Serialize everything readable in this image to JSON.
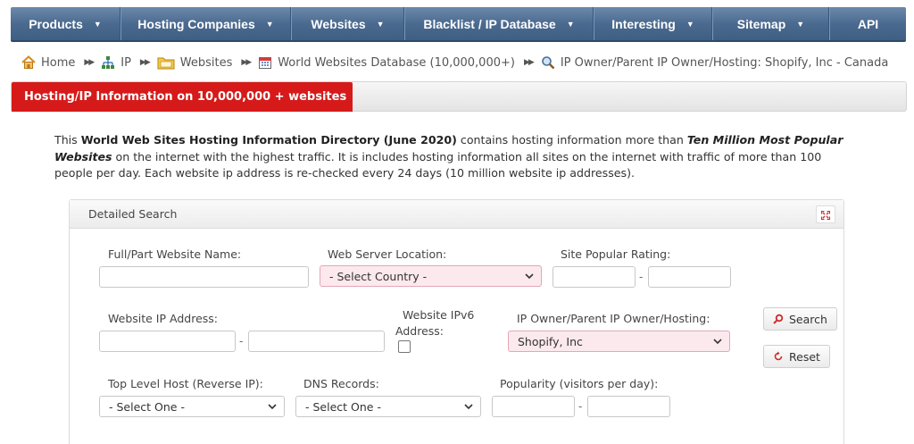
{
  "nav": {
    "items": [
      {
        "label": "Products",
        "has_caret": true,
        "width": 123
      },
      {
        "label": "Hosting Companies",
        "has_caret": true,
        "width": 191
      },
      {
        "label": "Websites",
        "has_caret": true,
        "width": 127
      },
      {
        "label": "Blacklist / IP Database",
        "has_caret": true,
        "width": 212
      },
      {
        "label": "Interesting",
        "has_caret": true,
        "width": 133
      },
      {
        "label": "Sitemap",
        "has_caret": true,
        "width": 131
      },
      {
        "label": "API",
        "has_caret": false,
        "width": 86
      }
    ],
    "caret": "▼"
  },
  "breadcrumb": {
    "home": "Home",
    "ip": "IP",
    "websites": "Websites",
    "database": "World Websites Database (10,000,000+)",
    "current": "IP Owner/Parent IP Owner/Hosting: Shopify, Inc - Canada",
    "separator": "▶▶"
  },
  "tab": {
    "label": "Hosting/IP Information on 10,000,000 + websites"
  },
  "intro": {
    "p1": "This ",
    "bold1": "World Web Sites Hosting Information Directory (June 2020)",
    "p2": " contains hosting information more than ",
    "bold2": "Ten Million Most Popular Websites",
    "p3": " on the internet with the highest traffic. It is includes hosting information all sites on the internet with traffic of more than 100 people per day. Each website ip address is re-checked every 24 days (10 million website ip addresses)."
  },
  "search": {
    "title": "Detailed Search",
    "website_name_label": "Full/Part Website Name:",
    "website_name_value": "",
    "server_location_label": "Web Server Location:",
    "server_location_value": "- Select Country -",
    "popular_rating_label": "Site Popular Rating:",
    "popular_from": "",
    "popular_to": "",
    "ip_label": "Website IP Address:",
    "ip_from": "",
    "ip_to": "",
    "ipv6_label_1": "Website IPv6",
    "ipv6_label_2": "Address:",
    "owner_label": "IP Owner/Parent IP Owner/Hosting:",
    "owner_value": "Shopify, Inc",
    "search_button": "Search",
    "reset_button": "Reset",
    "tld_label": "Top Level Host (Reverse IP):",
    "tld_value": "- Select One -",
    "dns_label": "DNS Records:",
    "dns_value": "- Select One -",
    "popularity_label": "Popularity (visitors per day):",
    "popularity_from": "",
    "popularity_to": "",
    "dash": "-"
  },
  "colors": {
    "nav_bg": "#4b6a8f",
    "tab_active": "#d61a1a",
    "select_highlight": "#fbe9ee"
  }
}
